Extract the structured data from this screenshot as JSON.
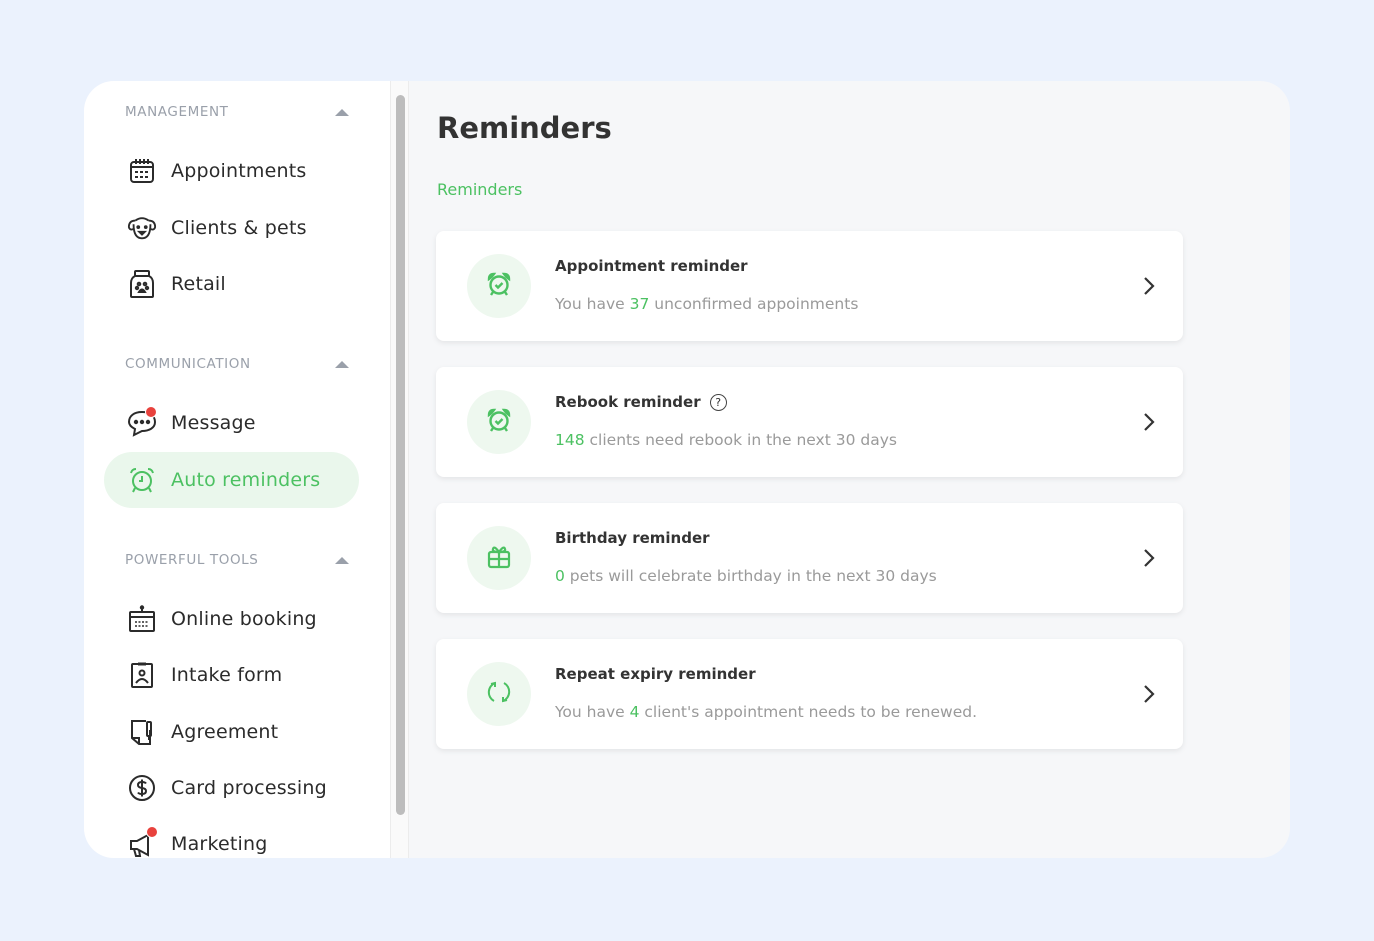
{
  "sidebar": {
    "sections": [
      {
        "title": "MANAGEMENT",
        "items": [
          {
            "label": "Appointments",
            "icon": "calendar-icon"
          },
          {
            "label": "Clients & pets",
            "icon": "dog-icon"
          },
          {
            "label": "Retail",
            "icon": "pet-food-bag-icon"
          }
        ]
      },
      {
        "title": "COMMUNICATION",
        "items": [
          {
            "label": "Message",
            "icon": "chat-bubble-icon",
            "badge": true
          },
          {
            "label": "Auto reminders",
            "icon": "alarm-clock-icon",
            "active": true
          }
        ]
      },
      {
        "title": "POWERFUL TOOLS",
        "items": [
          {
            "label": "Online booking",
            "icon": "booking-calendar-icon"
          },
          {
            "label": "Intake form",
            "icon": "clipboard-person-icon"
          },
          {
            "label": "Agreement",
            "icon": "document-pen-icon"
          },
          {
            "label": "Card processing",
            "icon": "dollar-circle-icon"
          },
          {
            "label": "Marketing",
            "icon": "megaphone-icon",
            "badge": true
          }
        ]
      }
    ]
  },
  "main": {
    "title": "Reminders",
    "breadcrumb": "Reminders",
    "cards": [
      {
        "title": "Appointment reminder",
        "icon": "alarm-clock-check-icon",
        "pre": "You have ",
        "num": "37",
        "post": " unconfirmed appoinments",
        "help": false
      },
      {
        "title": "Rebook reminder",
        "icon": "alarm-clock-check-icon",
        "pre": "",
        "num": "148",
        "post": " clients need rebook in the next 30 days",
        "help": true,
        "help_glyph": "?"
      },
      {
        "title": "Birthday reminder",
        "icon": "gift-icon",
        "pre": "",
        "num": "0",
        "post": " pets will celebrate birthday in the next 30 days",
        "help": false
      },
      {
        "title": "Repeat expiry reminder",
        "icon": "refresh-icon",
        "pre": "You have ",
        "num": "4",
        "post": " client's appointment needs to be renewed.",
        "help": false
      }
    ]
  },
  "colors": {
    "accent": "#4cc162",
    "accent_bg": "#eaf7ec",
    "badge": "#e8423d",
    "page_bg": "#ebf2fd"
  }
}
